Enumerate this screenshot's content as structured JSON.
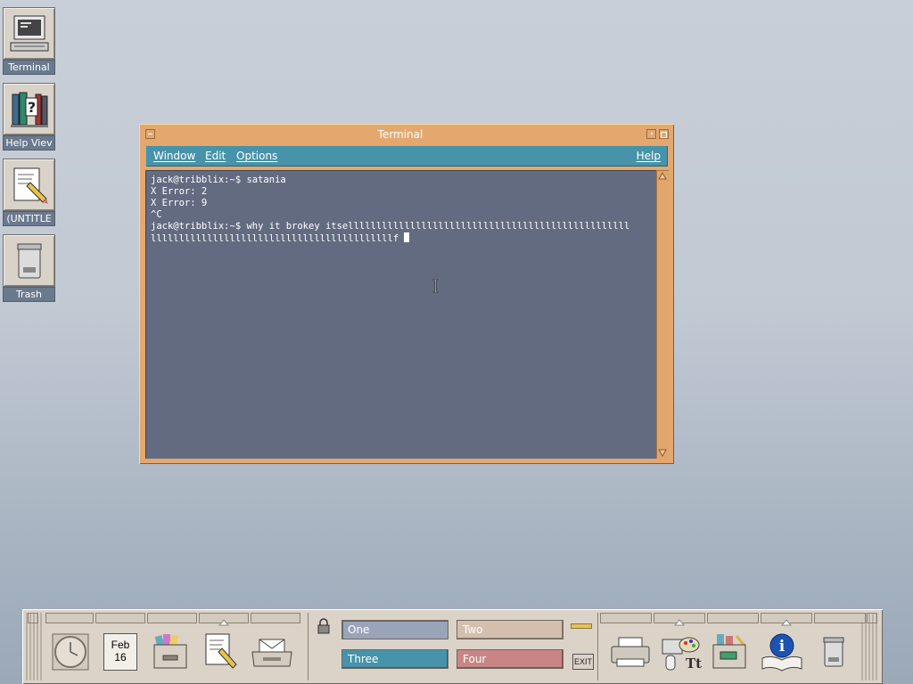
{
  "desktop_icons": [
    {
      "label": "Terminal",
      "icon": "terminal-computer-icon"
    },
    {
      "label": "Help Viev",
      "icon": "help-books-icon"
    },
    {
      "label": "(UNTITLE",
      "icon": "text-note-pencil-icon"
    },
    {
      "label": "Trash",
      "icon": "trash-can-icon"
    }
  ],
  "terminal": {
    "title": "Terminal",
    "menu": {
      "window": "Window",
      "edit": "Edit",
      "options": "Options",
      "help": "Help"
    },
    "lines": [
      "jack@tribblix:~$ satania",
      "X Error: 2",
      "X Error: 9",
      "^C",
      "jack@tribblix:~$ why it brokey itsellllllllllllllllllllllllllllllllllllllllllllllllll",
      "lllllllllllllllllllllllllllllllllllllllllllf "
    ]
  },
  "front_panel": {
    "clock_icon": "clock-icon",
    "calendar": {
      "month": "Feb",
      "day": "16"
    },
    "workspaces": [
      {
        "label": "One",
        "color": "#9aa4b8"
      },
      {
        "label": "Two",
        "color": "#d4bfae"
      },
      {
        "label": "Three",
        "color": "#4793a9"
      },
      {
        "label": "Four",
        "color": "#c98585"
      }
    ],
    "exit_label": "EXIT",
    "colors": {
      "panel": "#dcd3c8",
      "accent": "#4793a9",
      "window_frame": "#e4a86f",
      "terminal_bg": "#636b81"
    }
  }
}
